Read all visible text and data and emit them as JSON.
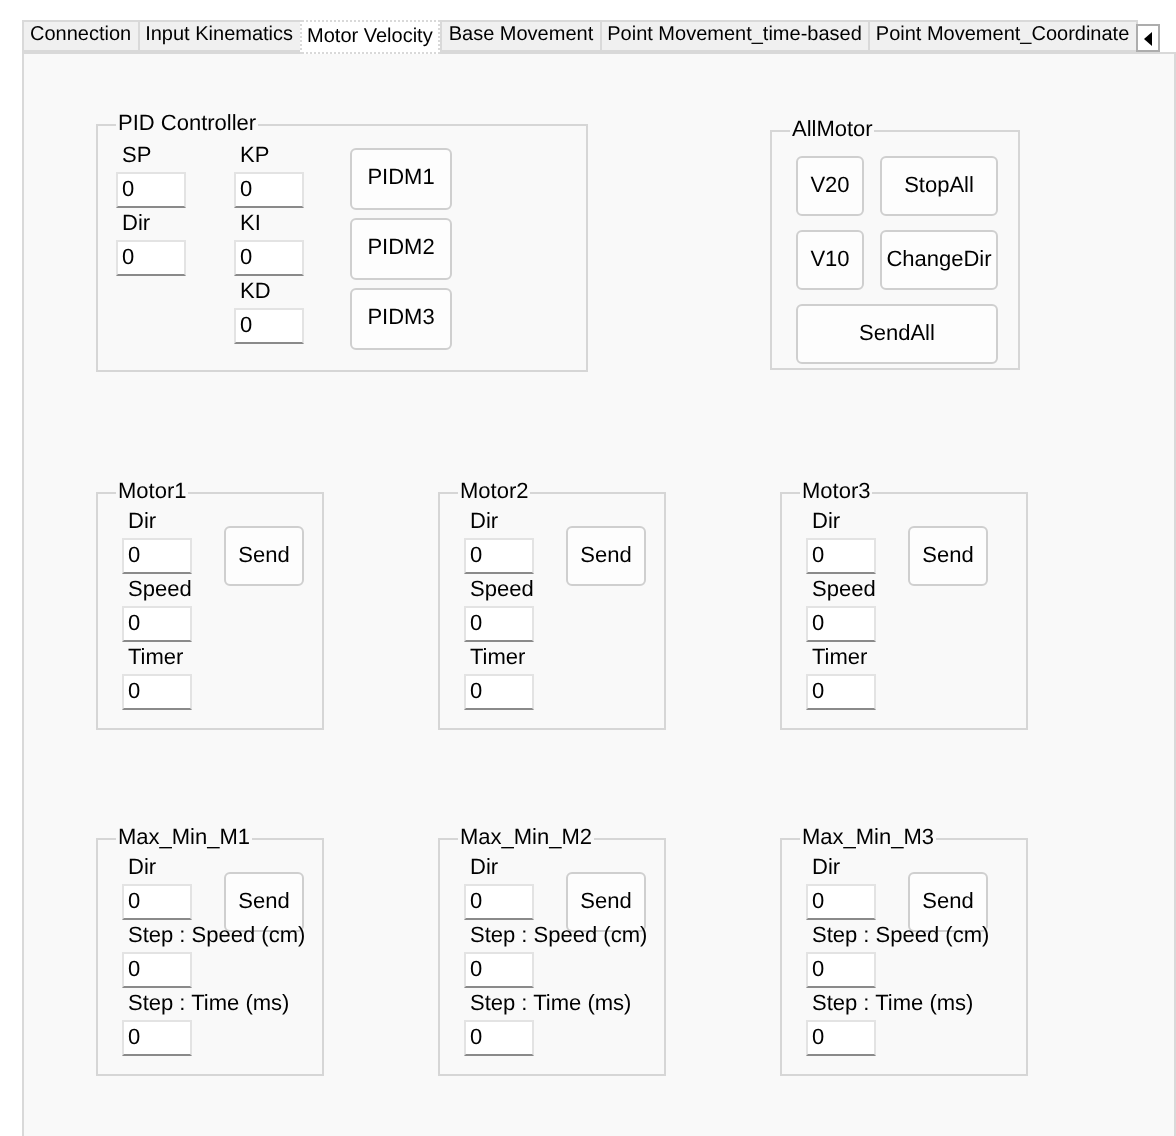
{
  "tabs": [
    {
      "label": "Connection",
      "selected": false
    },
    {
      "label": "Input Kinematics",
      "selected": false
    },
    {
      "label": "Motor Velocity",
      "selected": true
    },
    {
      "label": "Base Movement",
      "selected": false
    },
    {
      "label": "Point Movement_time-based",
      "selected": false
    },
    {
      "label": "Point Movement_Coordinate",
      "selected": false
    }
  ],
  "pid_controller": {
    "title": "PID Controller",
    "columns": [
      [
        {
          "label": "SP",
          "value": "0"
        },
        {
          "label": "Dir",
          "value": "0"
        }
      ],
      [
        {
          "label": "KP",
          "value": "0"
        },
        {
          "label": "KI",
          "value": "0"
        },
        {
          "label": "KD",
          "value": "0"
        }
      ]
    ],
    "buttons": [
      "PIDM1",
      "PIDM2",
      "PIDM3"
    ]
  },
  "all_motor": {
    "title": "AllMotor",
    "buttons": [
      "V20",
      "StopAll",
      "V10",
      "ChangeDir",
      "SendAll"
    ]
  },
  "motors": [
    {
      "title": "Motor1",
      "button": "Send",
      "fields": [
        {
          "label": "Dir",
          "value": "0"
        },
        {
          "label": "Speed",
          "value": "0"
        },
        {
          "label": "Timer",
          "value": "0"
        }
      ]
    },
    {
      "title": "Motor2",
      "button": "Send",
      "fields": [
        {
          "label": "Dir",
          "value": "0"
        },
        {
          "label": "Speed",
          "value": "0"
        },
        {
          "label": "Timer",
          "value": "0"
        }
      ]
    },
    {
      "title": "Motor3",
      "button": "Send",
      "fields": [
        {
          "label": "Dir",
          "value": "0"
        },
        {
          "label": "Speed",
          "value": "0"
        },
        {
          "label": "Timer",
          "value": "0"
        }
      ]
    }
  ],
  "limits": [
    {
      "title": "Max_Min_M1",
      "button": "Send",
      "fields": [
        {
          "label": "Dir",
          "value": "0"
        },
        {
          "label": "Step : Speed (cm)",
          "value": "0"
        },
        {
          "label": "Step : Time (ms)",
          "value": "0"
        }
      ]
    },
    {
      "title": "Max_Min_M2",
      "button": "Send",
      "fields": [
        {
          "label": "Dir",
          "value": "0"
        },
        {
          "label": "Step : Speed (cm)",
          "value": "0"
        },
        {
          "label": "Step : Time (ms)",
          "value": "0"
        }
      ]
    },
    {
      "title": "Max_Min_M3",
      "button": "Send",
      "fields": [
        {
          "label": "Dir",
          "value": "0"
        },
        {
          "label": "Step : Speed (cm)",
          "value": "0"
        },
        {
          "label": "Step : Time (ms)",
          "value": "0"
        }
      ]
    }
  ]
}
